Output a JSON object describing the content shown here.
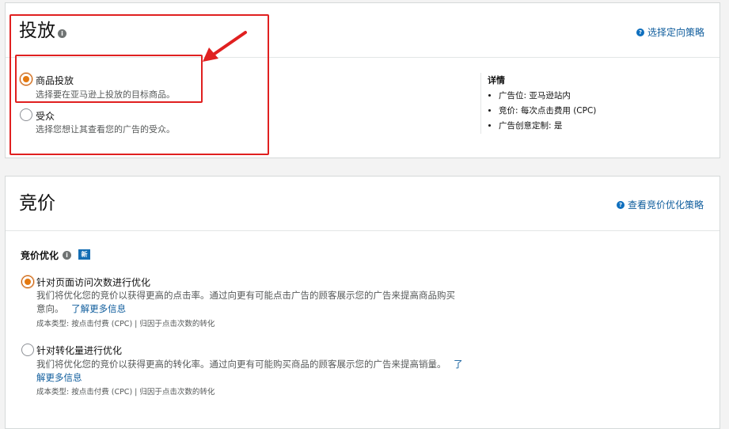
{
  "targeting": {
    "title": "投放",
    "info_icon": "info-icon",
    "link": "选择定向策略",
    "options": [
      {
        "label": "商品投放",
        "desc": "选择要在亚马逊上投放的目标商品。",
        "checked": true
      },
      {
        "label": "受众",
        "desc": "选择您想让其查看您的广告的受众。",
        "checked": false
      }
    ],
    "details": {
      "title": "详情",
      "items": [
        "广告位:  亚马逊站内",
        "竞价:  每次点击费用 (CPC)",
        "广告创意定制:  是"
      ]
    }
  },
  "bidding": {
    "title": "竞价",
    "link": "查看竞价优化策略",
    "section_label": "竞价优化",
    "new_badge": "新",
    "options": [
      {
        "label": "针对页面访问次数进行优化",
        "desc_line1": "我们将优化您的竞价以获得更高的点击率。通过向更有可能点击广告的顾客展示您的广告来提高商品购买",
        "desc_line2_text": "意向。",
        "learn_more": "了解更多信息",
        "meta": "成本类型:  按点击付费 (CPC) | 归因于点击次数的转化",
        "checked": true
      },
      {
        "label": "针对转化量进行优化",
        "desc_line1": "我们将优化您的竞价以获得更高的转化率。通过向更有可能购买商品的顾客展示您的广告来提高销量。",
        "learn_more_part1": "了",
        "learn_more_part2": "解更多信息",
        "meta": "成本类型:  按点击付费 (CPC) | 归因于点击次数的转化",
        "checked": false
      }
    ]
  },
  "colors": {
    "accent_orange": "#e47911",
    "link_blue": "#0e5c9c",
    "annotation_red": "#e02020"
  }
}
